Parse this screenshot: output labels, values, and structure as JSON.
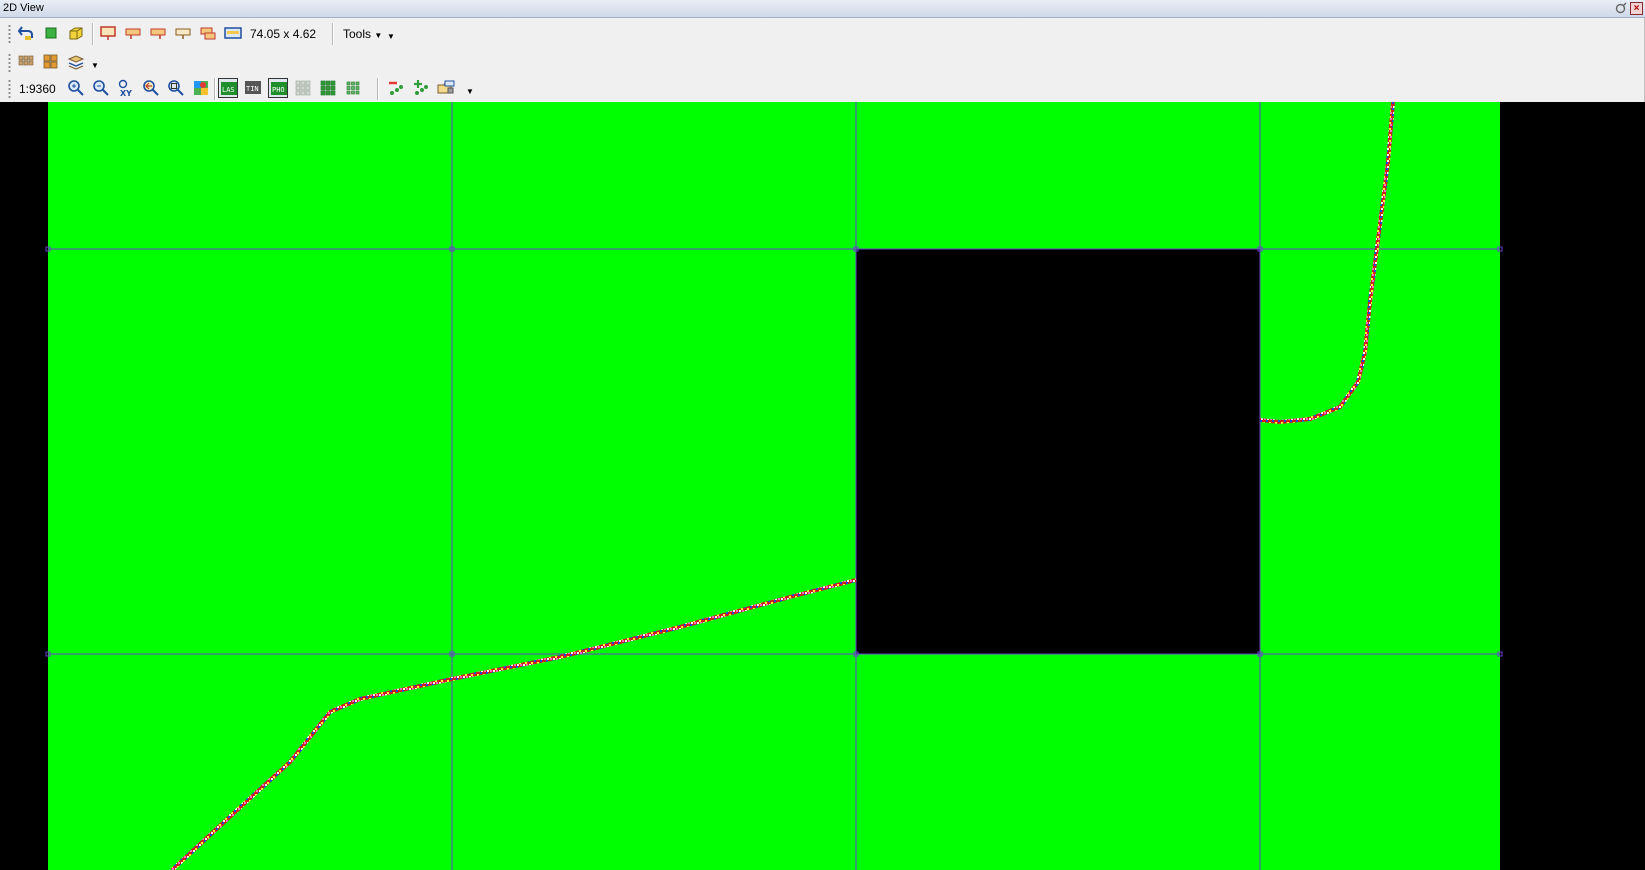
{
  "window": {
    "title": "2D View"
  },
  "toolbar": {
    "dimensions_readout": "74.05 x 4.62",
    "tools_menu_label": "Tools",
    "scale_readout": "1:9360",
    "las_toggle_label": "LAS",
    "tin_toggle_label": "TIN",
    "pho_toggle_label": "PHO"
  },
  "icons": {
    "row1": [
      "undo-arrow-icon",
      "green-square-icon",
      "yellow-cube-icon",
      "red-frame-icon",
      "flag-tool-icon-1",
      "flag-tool-icon-2",
      "flag-tool-icon-3",
      "flag-tool-icon-4",
      "flag-tool-icon-5",
      "monitor-icon",
      "chevron-down-icon"
    ],
    "row2": [
      "grid-small-icon",
      "grid-large-icon",
      "layers-icon",
      "chevron-down-icon"
    ],
    "row3": [
      "zoom-in-icon",
      "zoom-out-icon",
      "xy-zoom-icon",
      "zoom-previous-icon",
      "zoom-extent-icon",
      "map-pin-icon",
      "las-toggle-icon",
      "tin-toggle-icon",
      "pho-toggle-icon",
      "grid-off-icon",
      "grid-on-icon",
      "grid-dense-icon",
      "remove-points-icon",
      "add-points-icon",
      "folder-settings-icon",
      "chevron-down-icon"
    ]
  },
  "colors": {
    "tile_fill": "#00ff00",
    "empty_tile": "#000000",
    "grid_line": "#6a3fd0",
    "viewport_bg": "#000000"
  }
}
